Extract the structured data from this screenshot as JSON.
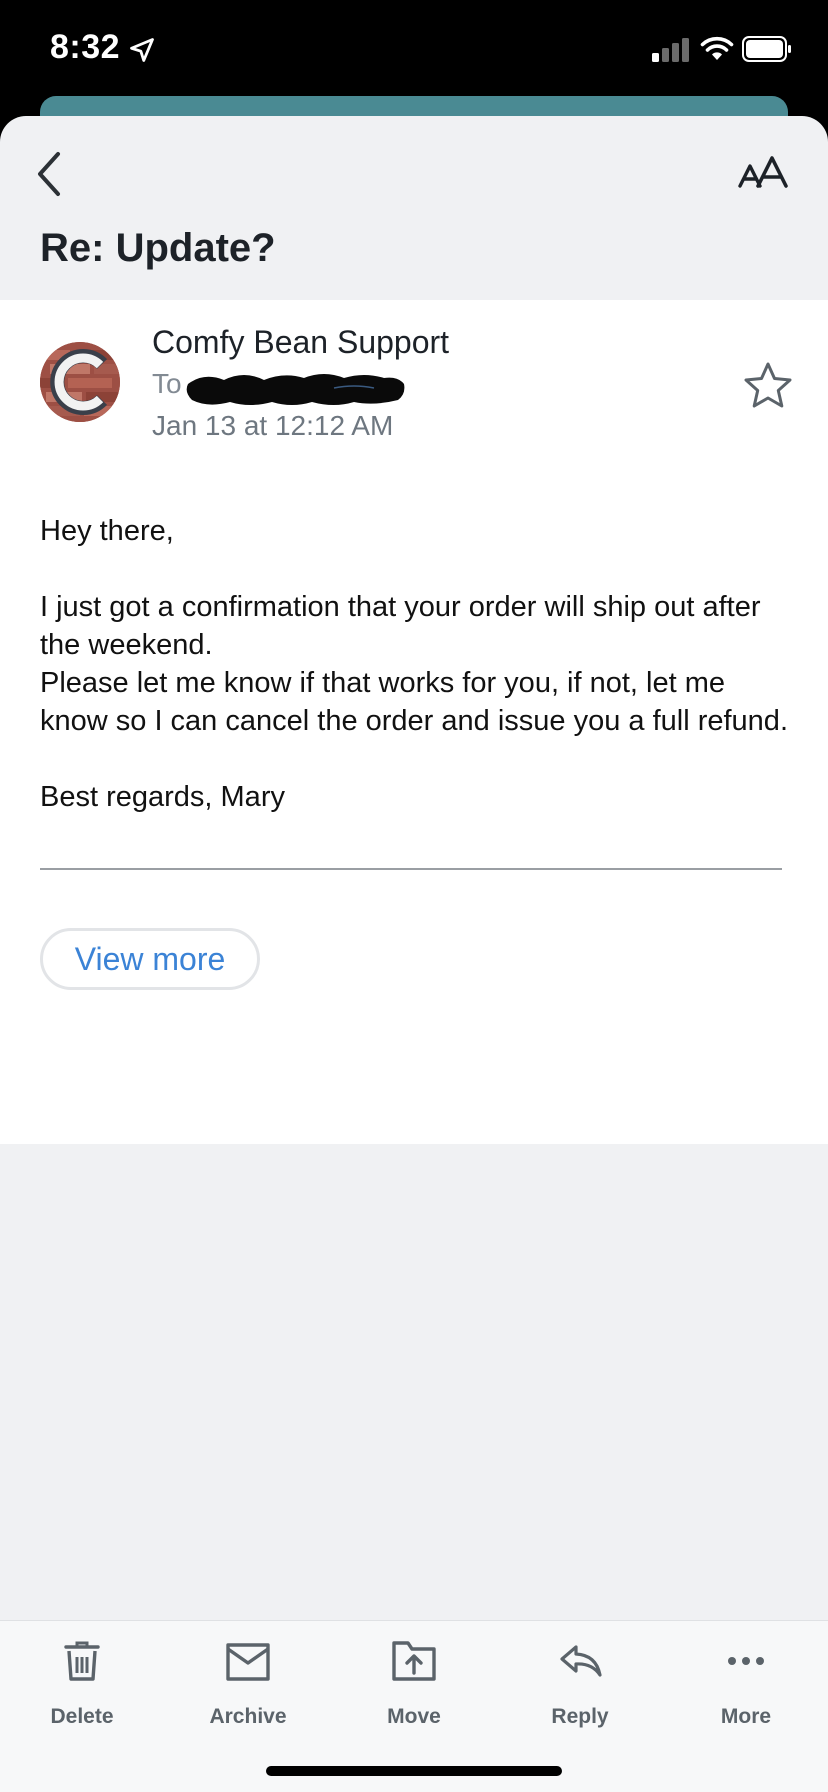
{
  "status_bar": {
    "time": "8:32"
  },
  "header": {
    "subject": "Re: Update?"
  },
  "message": {
    "sender": "Comfy Bean Support",
    "to_label": "To",
    "date": "Jan 13 at 12:12 AM",
    "avatar_letter": "C",
    "body": {
      "greeting": "Hey there,",
      "line1": "I just got a confirmation that your order will ship out after the weekend.",
      "line2": "Please let me know if that works for you, if not, let me know so I can cancel the order and issue you a full refund.",
      "signoff": "Best regards, Mary"
    },
    "view_more_label": "View more"
  },
  "toolbar": {
    "items": [
      {
        "label": "Delete",
        "icon": "trash-icon"
      },
      {
        "label": "Archive",
        "icon": "archive-icon"
      },
      {
        "label": "Move",
        "icon": "move-icon"
      },
      {
        "label": "Reply",
        "icon": "reply-icon"
      },
      {
        "label": "More",
        "icon": "more-icon"
      }
    ]
  },
  "colors": {
    "accent_link": "#3b83d6",
    "teal_sheet": "#4a8a93",
    "avatar_brick": "#a3564a"
  }
}
